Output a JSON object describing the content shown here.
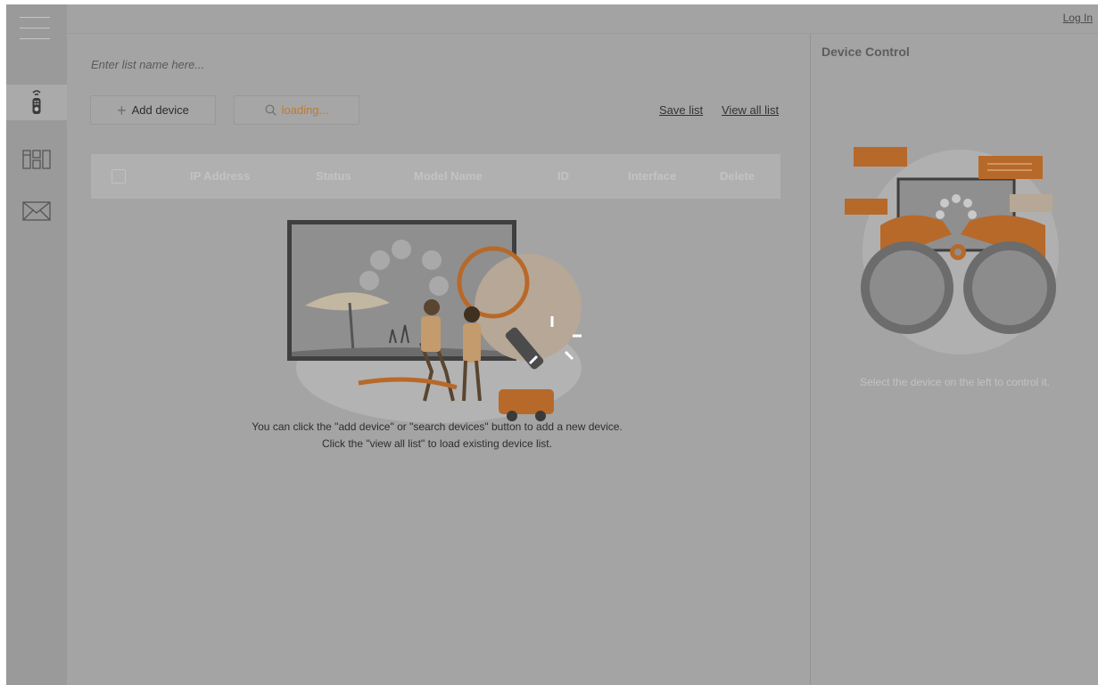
{
  "topbar": {
    "login": "Log In"
  },
  "sidebar": {
    "items": [
      {
        "icon": "remote-control-icon",
        "active": true
      },
      {
        "icon": "layout-panels-icon",
        "active": false
      },
      {
        "icon": "mail-icon",
        "active": false
      }
    ]
  },
  "main": {
    "list_name_placeholder": "Enter list name here...",
    "add_device_label": "Add device",
    "search_label": "loading...",
    "save_list": "Save list",
    "view_all_list": "View all list",
    "table": {
      "headers": [
        "IP Address",
        "Status",
        "Model Name",
        "ID",
        "Interface",
        "Delete"
      ]
    },
    "empty_line1": "You can click the \"add device\" or \"search devices\" button to add a new device.",
    "empty_line2": "Click the \"view all list\" to load existing device list."
  },
  "device_control": {
    "title": "Device Control",
    "message": "Select the device on the left to control it."
  },
  "colors": {
    "accent": "#c07a30",
    "overlay": "#a4a4a4",
    "sidebar": "#9a9a9a"
  }
}
